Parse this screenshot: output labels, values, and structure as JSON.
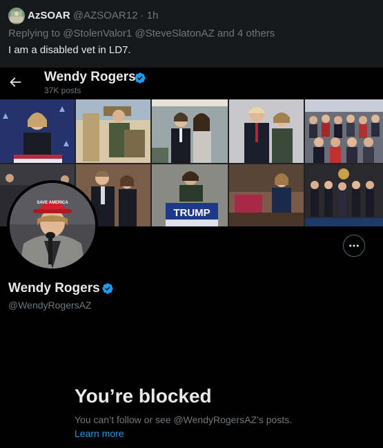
{
  "reply_post": {
    "author_name": "AzSOAR",
    "author_handle": "@AZSOAR12",
    "separator": "·",
    "time": "1h",
    "replying_to": "Replying to @StolenValor1 @SteveSlatonAZ and 4 others",
    "text": "I am a disabled vet in LD7."
  },
  "profile": {
    "header_title": "Wendy Rogers",
    "posts_count": "37K posts",
    "display_name": "Wendy Rogers",
    "username": "@WendyRogersAZ",
    "verified": true,
    "banner_sign_text": "TRUMP",
    "hat_text": "SAVE AMERICA",
    "blocked_title": "You’re blocked",
    "blocked_description": "You can’t follow or see @WendyRogersAZ’s posts.",
    "learn_more": "Learn more"
  },
  "icons": {
    "back": "back-arrow-icon",
    "verified": "verified-badge-icon",
    "more": "more-options-icon"
  },
  "colors": {
    "background": "#000000",
    "post_background": "#16181c",
    "primary_text": "#e7e9ea",
    "secondary_text": "#71767b",
    "link": "#1d9bf0",
    "verified": "#1d9bf0"
  }
}
